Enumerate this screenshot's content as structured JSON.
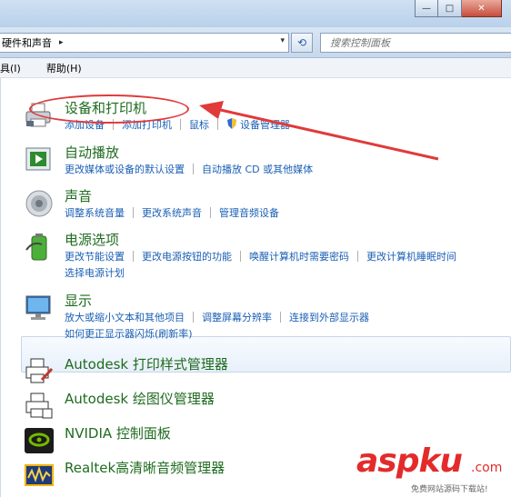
{
  "window": {
    "controls": {
      "minimize": "—",
      "maximize": "□",
      "close": "✕"
    }
  },
  "address": {
    "breadcrumb": "硬件和声音",
    "separator": "▸",
    "dropdown": "▾",
    "refresh": "⟲",
    "search_placeholder": "搜索控制面板"
  },
  "menus": [
    "具(I)",
    "帮助(H)"
  ],
  "groups": [
    {
      "id": "devices-printers",
      "icon": "printer-icon",
      "title": "设备和打印机",
      "lines": [
        [
          "添加设备",
          "添加打印机",
          "鼠标",
          "设备管理器"
        ]
      ]
    },
    {
      "id": "autoplay",
      "icon": "autoplay-icon",
      "title": "自动播放",
      "lines": [
        [
          "更改媒体或设备的默认设置",
          "自动播放 CD 或其他媒体"
        ]
      ]
    },
    {
      "id": "sound",
      "icon": "speaker-icon",
      "title": "声音",
      "lines": [
        [
          "调整系统音量",
          "更改系统声音",
          "管理音频设备"
        ]
      ]
    },
    {
      "id": "power",
      "icon": "battery-icon",
      "title": "电源选项",
      "lines": [
        [
          "更改节能设置",
          "更改电源按钮的功能",
          "唤醒计算机时需要密码",
          "更改计算机睡眠时间"
        ],
        [
          "选择电源计划"
        ]
      ]
    },
    {
      "id": "display",
      "icon": "monitor-icon",
      "title": "显示",
      "lines": [
        [
          "放大或缩小文本和其他项目",
          "调整屏幕分辨率",
          "连接到外部显示器"
        ],
        [
          "如何更正显示器闪烁(刷新率)"
        ]
      ]
    },
    {
      "id": "autodesk-plot-style",
      "icon": "plot-style-printer-icon",
      "title": "Autodesk 打印样式管理器",
      "lines": []
    },
    {
      "id": "autodesk-plotter",
      "icon": "plotter-icon",
      "title": "Autodesk 绘图仪管理器",
      "lines": []
    },
    {
      "id": "nvidia",
      "icon": "nvidia-icon",
      "title": "NVIDIA 控制面板",
      "lines": []
    },
    {
      "id": "realtek",
      "icon": "realtek-audio-icon",
      "title": "Realtek高清晰音频管理器",
      "lines": []
    }
  ],
  "watermark": {
    "brand": "aspku",
    "suffix": ".com",
    "tagline": "免费网站源码下载站!"
  },
  "colors": {
    "title_green": "#1f6b1f",
    "link_blue": "#1a5fb4",
    "annotation_red": "#e03a3a"
  }
}
